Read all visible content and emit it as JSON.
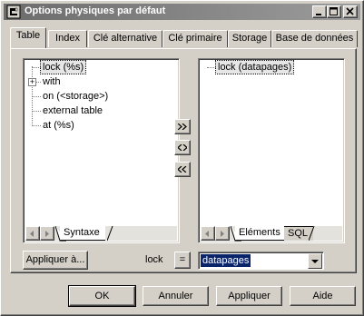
{
  "window": {
    "title": "Options physiques par défaut",
    "controls": {
      "minimize": "_",
      "maximize": "□",
      "close": "×"
    }
  },
  "tabs": [
    {
      "label": "Table",
      "active": true
    },
    {
      "label": "Index",
      "active": false
    },
    {
      "label": "Clé alternative",
      "active": false
    },
    {
      "label": "Clé primaire",
      "active": false
    },
    {
      "label": "Storage",
      "active": false
    },
    {
      "label": "Base de données",
      "active": false
    }
  ],
  "left_tree": {
    "items": [
      {
        "label": "lock (%s)",
        "selected": true,
        "expandable": false
      },
      {
        "label": "with",
        "selected": false,
        "expandable": true
      },
      {
        "label": "on (<storage>)",
        "selected": false,
        "expandable": false
      },
      {
        "label": "external table",
        "selected": false,
        "expandable": false
      },
      {
        "label": "at (%s)",
        "selected": false,
        "expandable": false
      }
    ],
    "subtab": "Syntaxe"
  },
  "right_tree": {
    "items": [
      {
        "label": "lock (datapages)",
        "selected": true
      }
    ],
    "subtabs": [
      "Eléments",
      "SQL"
    ]
  },
  "transfer_buttons": {
    "add": ">>",
    "swap": "<>",
    "remove": "<<"
  },
  "apply_to_button": "Appliquer à...",
  "property": {
    "name": "lock",
    "equals": "=",
    "value": "datapages"
  },
  "footer": {
    "ok": "OK",
    "cancel": "Annuler",
    "apply": "Appliquer",
    "help": "Aide"
  }
}
